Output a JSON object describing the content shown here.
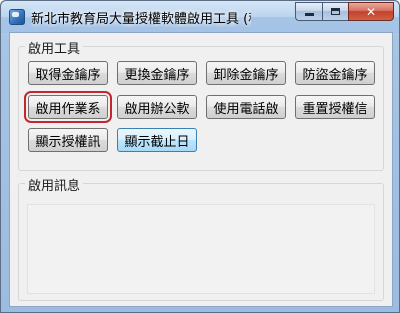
{
  "window": {
    "title": "新北市教育局大量授權軟體啟用工具 (程...",
    "controls": {
      "minimize": "",
      "maximize": "",
      "close": "✕"
    }
  },
  "tools_group": {
    "label": "啟用工具",
    "buttons": [
      {
        "label": "取得金鑰序"
      },
      {
        "label": "更換金鑰序"
      },
      {
        "label": "卸除金鑰序"
      },
      {
        "label": "防盜金鑰序"
      },
      {
        "label": "啟用作業系"
      },
      {
        "label": "啟用辦公軟"
      },
      {
        "label": "使用電話啟"
      },
      {
        "label": "重置授權信"
      },
      {
        "label": "顯示授權訊"
      },
      {
        "label": "顯示截止日"
      }
    ]
  },
  "message_group": {
    "label": "啟用訊息",
    "content": ""
  }
}
